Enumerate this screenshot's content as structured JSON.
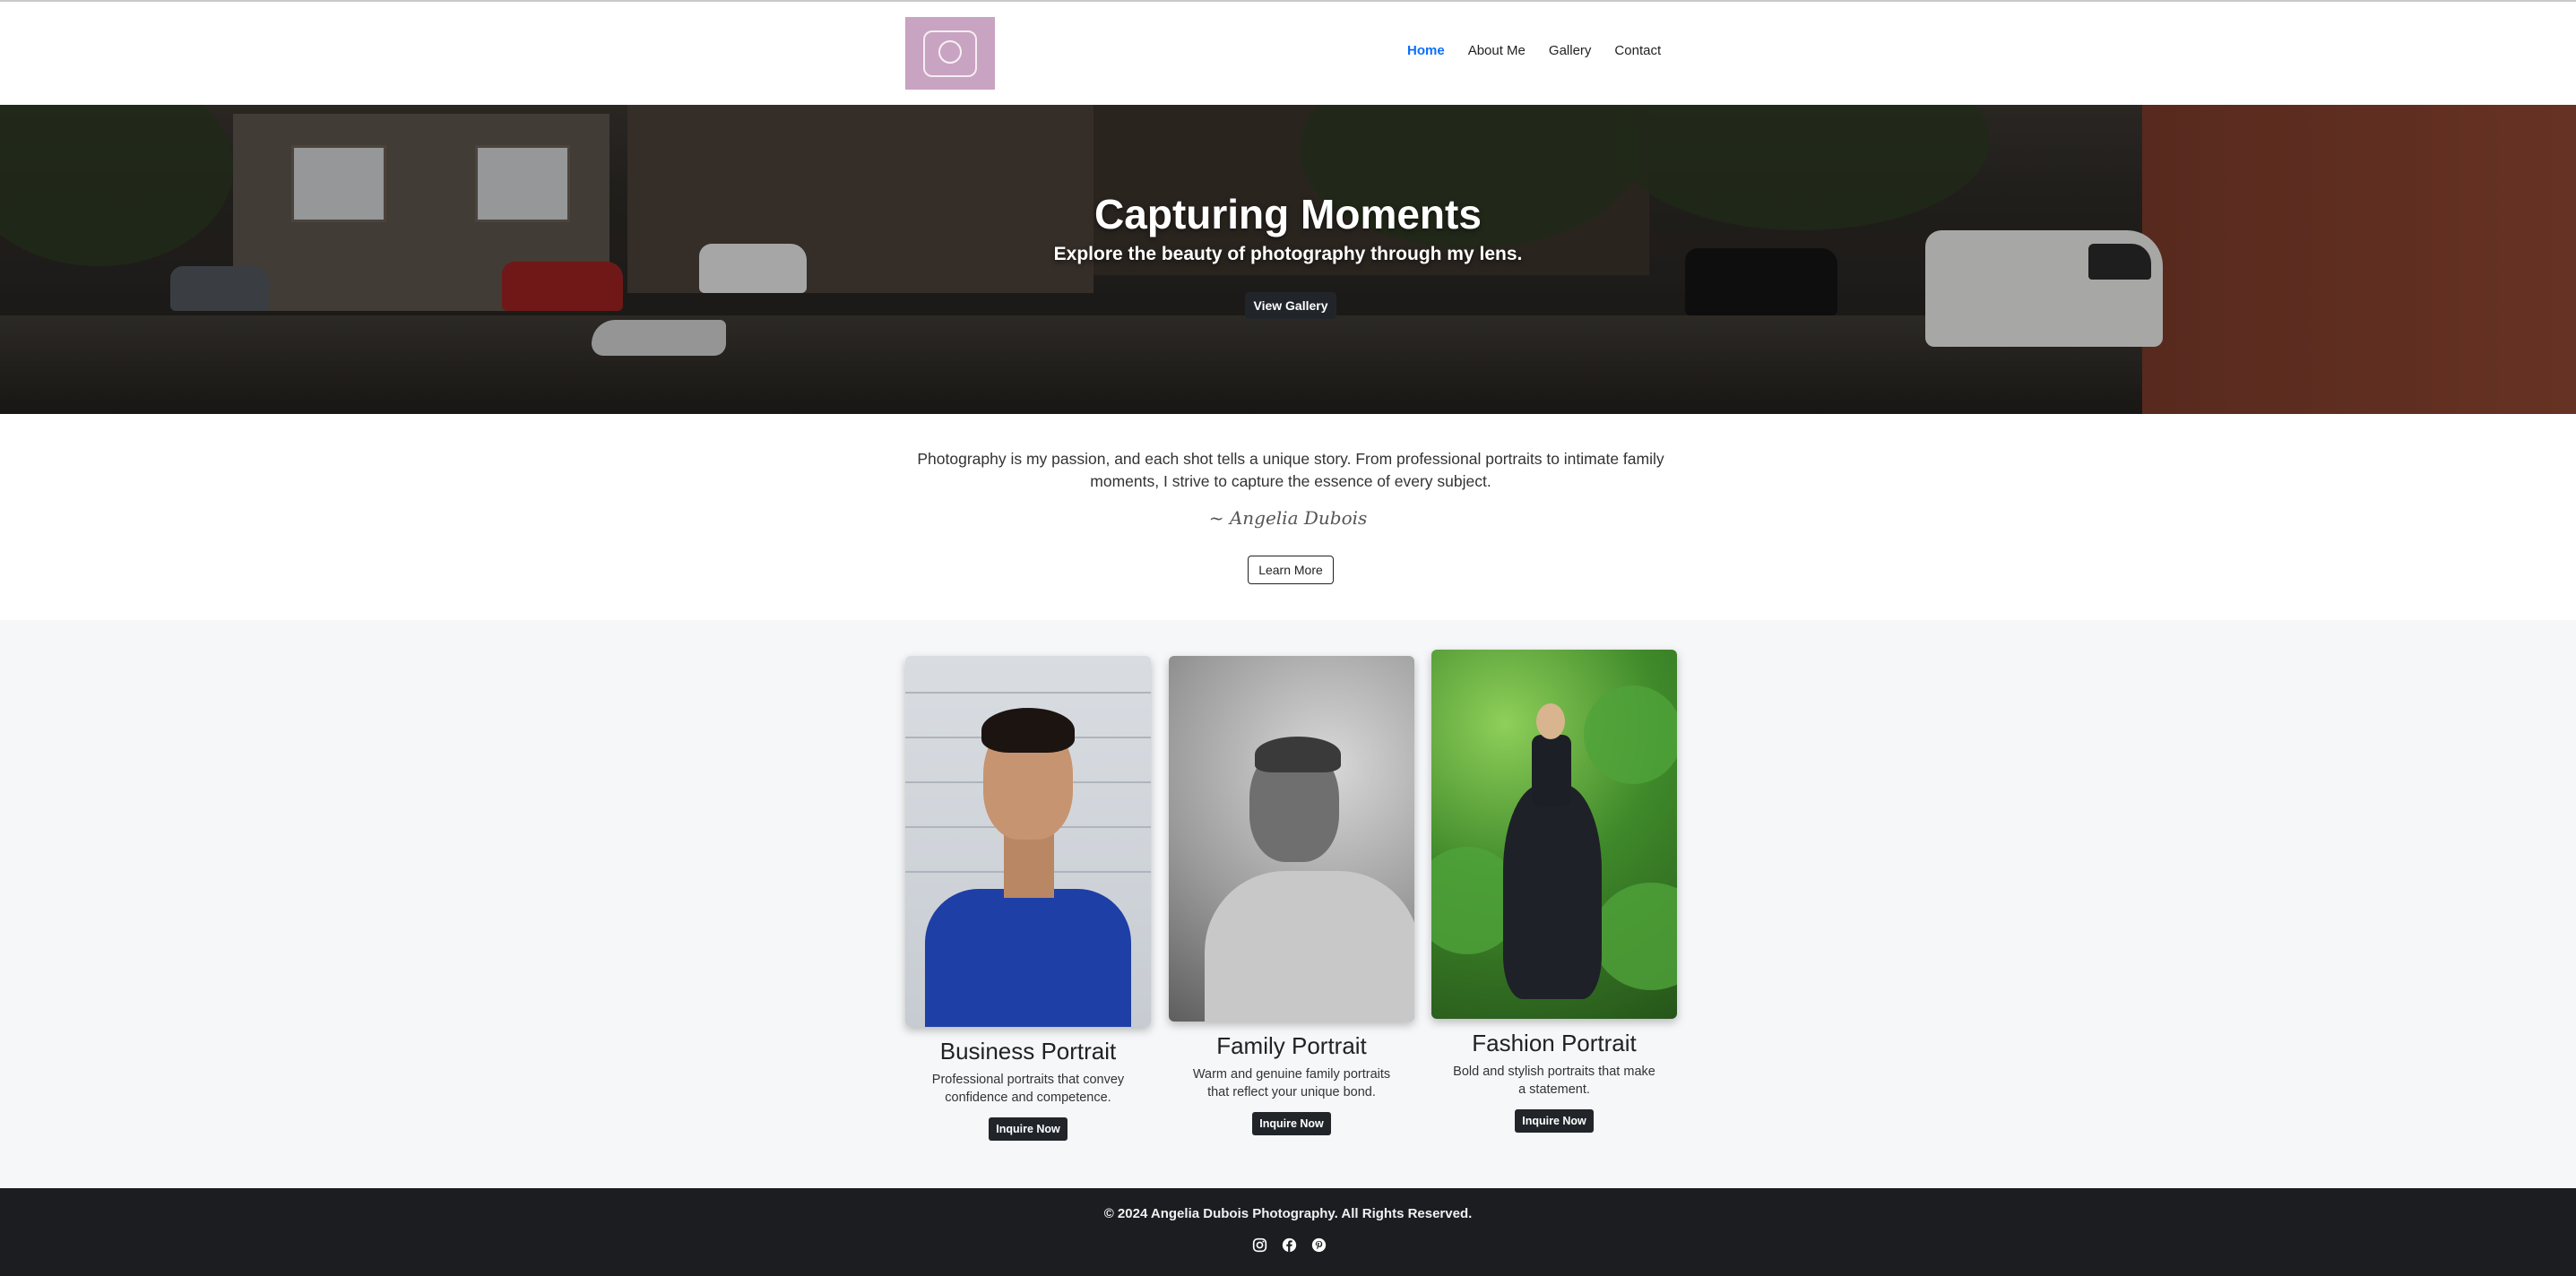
{
  "nav": {
    "logo_alt": "Angelia Dubois Photography logo",
    "links": [
      "Home",
      "About Me",
      "Gallery",
      "Contact"
    ],
    "active": "Home"
  },
  "hero": {
    "title": "Capturing Moments",
    "subtitle": "Explore the beauty of photography through my lens.",
    "button": "View Gallery"
  },
  "about": {
    "text": "Photography is my passion, and each shot tells a unique story. From professional portraits to intimate family moments, I strive to capture the essence of every subject.",
    "signature": "~ Angelia Dubois",
    "button": "Learn More"
  },
  "services": [
    {
      "title": "Business Portrait",
      "description": "Professional portraits that convey confidence and competence.",
      "button": "Inquire Now"
    },
    {
      "title": "Family Portrait",
      "description": "Warm and genuine family portraits that reflect your unique bond.",
      "button": "Inquire Now"
    },
    {
      "title": "Fashion Portrait",
      "description": "Bold and stylish portraits that make a statement.",
      "button": "Inquire Now"
    }
  ],
  "footer": {
    "copyright": "© 2024 Angelia Dubois Photography. All Rights Reserved.",
    "social_icons": [
      "instagram-icon",
      "facebook-icon",
      "pinterest-icon"
    ]
  },
  "colors": {
    "accent": "#0d6efd",
    "button_dark": "#212529",
    "footer_bg": "#1b1d21",
    "section_bg": "#f6f7f9"
  }
}
